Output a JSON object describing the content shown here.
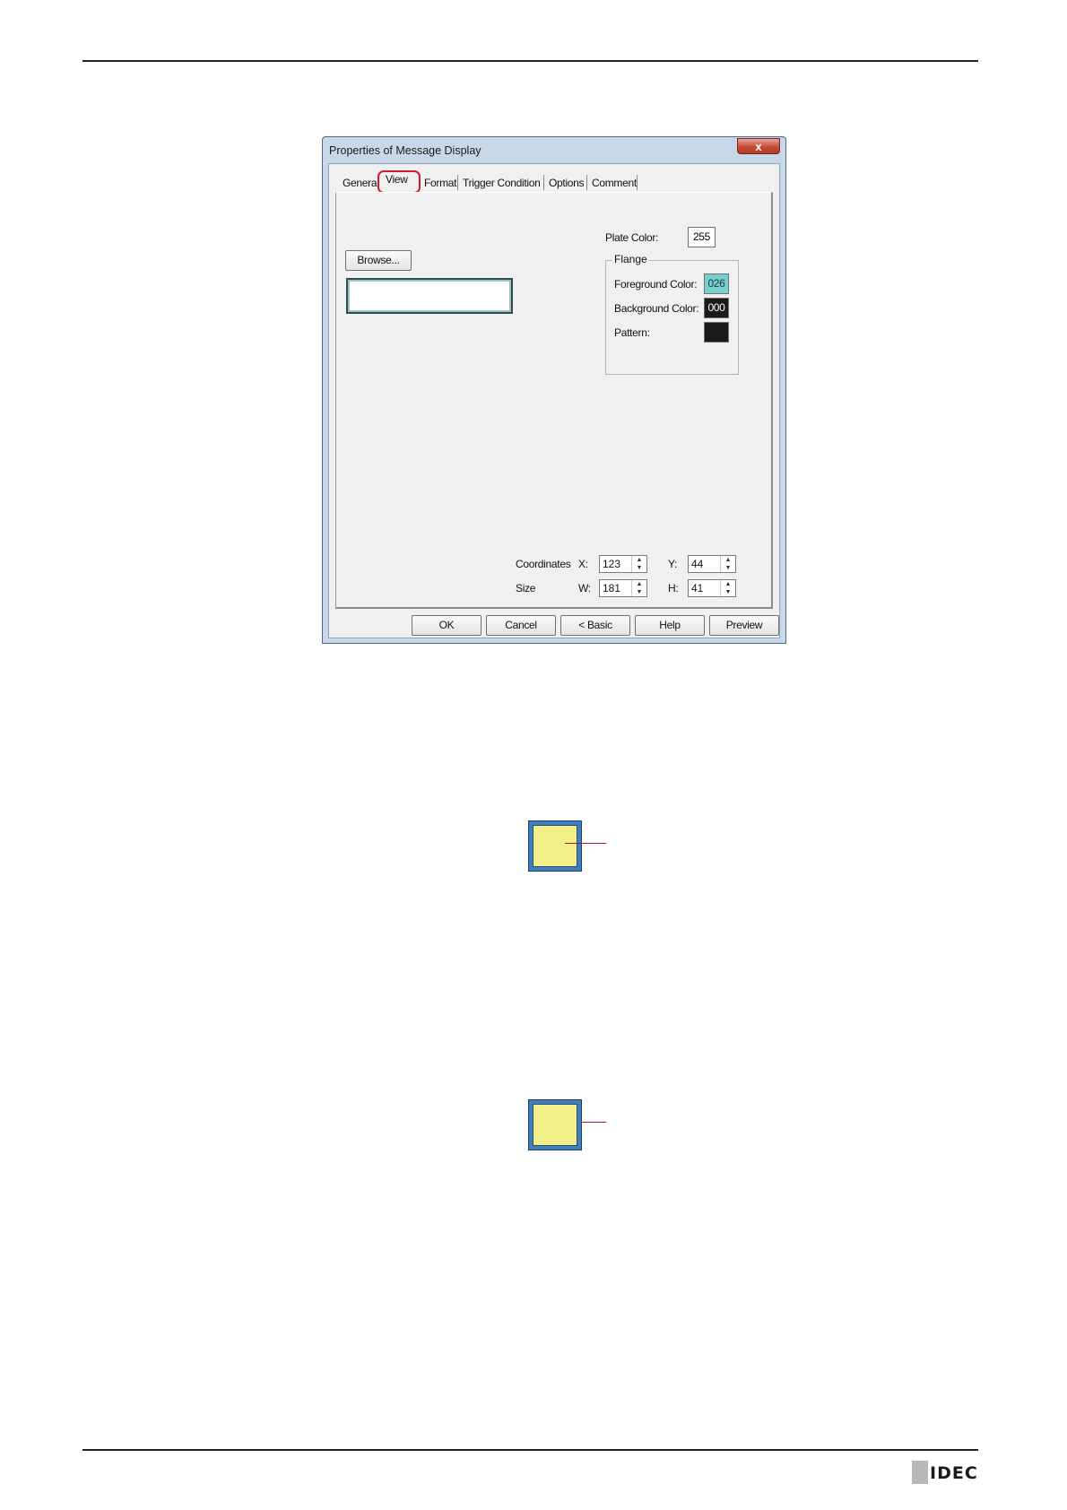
{
  "dialog": {
    "title": "Properties of Message Display",
    "close_glyph": "x",
    "tabs": [
      "General",
      "View",
      "Format",
      "Trigger Condition",
      "Options",
      "Comment"
    ],
    "active_tab": "View",
    "browse_label": "Browse...",
    "plate_color": {
      "label": "Plate Color:",
      "value": "255",
      "color": "#ffffff"
    },
    "flange": {
      "legend": "Flange",
      "foreground": {
        "label": "Foreground Color:",
        "value": "026",
        "color": "#78cfcf"
      },
      "background": {
        "label": "Background Color:",
        "value": "000",
        "color": "#1a1a1a"
      },
      "pattern": {
        "label": "Pattern:",
        "color": "#1a1a1a"
      }
    },
    "coordinates": {
      "label": "Coordinates",
      "x_label": "X:",
      "x_value": "123",
      "y_label": "Y:",
      "y_value": "44"
    },
    "size": {
      "label": "Size",
      "w_label": "W:",
      "w_value": "181",
      "h_label": "H:",
      "h_value": "41"
    },
    "buttons": {
      "ok": "OK",
      "cancel": "Cancel",
      "basic": "< Basic",
      "help": "Help",
      "preview": "Preview"
    }
  },
  "samples": {
    "border_color": "#3d7fbf",
    "fill_color": "#f2ef86",
    "callout_color": "#a01830"
  },
  "logo": {
    "text": "IDEC"
  }
}
